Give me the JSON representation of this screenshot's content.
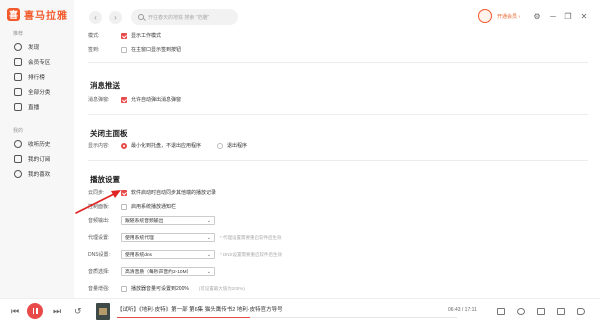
{
  "app": {
    "logo_text": "喜马拉雅",
    "logo_mark": "喜"
  },
  "sidebar": {
    "section1_label": "推荐",
    "items1": [
      {
        "label": "发现",
        "icon": "compass-icon"
      },
      {
        "label": "会员专区",
        "icon": "vip-icon"
      },
      {
        "label": "排行榜",
        "icon": "ranking-icon"
      },
      {
        "label": "全部分类",
        "icon": "category-icon"
      },
      {
        "label": "直播",
        "icon": "live-icon"
      }
    ],
    "section2_label": "我的",
    "items2": [
      {
        "label": "收听历史",
        "icon": "history-icon"
      },
      {
        "label": "我的订阅",
        "icon": "subscribe-icon"
      },
      {
        "label": "我的喜欢",
        "icon": "like-icon"
      }
    ]
  },
  "topbar": {
    "back": "‹",
    "forward": "›",
    "search_placeholder": "开往春天的地铁 搜索 \"范雕\"",
    "vip_label": "开通会员",
    "vip_arrow": "›",
    "win_ctrls": [
      "⚙",
      "─",
      "❐",
      "✕"
    ]
  },
  "settings": {
    "mode_label": "模式:",
    "mode_option": "显示工作模式",
    "sign_label": "签到:",
    "sign_option": "在主窗口显示签到按钮",
    "push_title": "消息推送",
    "push_label": "消息弹窗:",
    "push_option": "允许自动弹出消息弹窗",
    "close_title": "关闭主面板",
    "close_label": "显示内容:",
    "close_option1": "最小化到托盘，不退出应用程序",
    "close_option2": "退出程序",
    "play_title": "播放设置",
    "cloud_label": "云同步:",
    "cloud_option": "软件启动时自动同步其他端的播放记录",
    "control_label": "控制面板:",
    "control_option": "启用系统播放通知栏",
    "audio_out_label": "音频输出:",
    "audio_out_value": "跟随系统音频输出",
    "proxy_label": "代理设置:",
    "proxy_value": "使用系统代理",
    "proxy_hint": "* 代理设置需要重启软件后生效",
    "dns_label": "DNS设置:",
    "dns_value": "使用系统dns",
    "dns_hint": "* DNS设置需要重启软件后生效",
    "quality_label": "音质选择:",
    "quality_value": "高清音质（每秒声音约2-10M）",
    "boost_label": "音量增强:",
    "boost_option": "播放器音量可设置到200%",
    "boost_hint": "(可设置最大值为200%)",
    "select_arrow": "⌄"
  },
  "player": {
    "prev": "⏮",
    "next": "⏭",
    "rewind": "↺",
    "forward15": "↻",
    "track_title": "【试听】《地利·皮特》第一部 第6集 猫头鹰传书2  地利·皮特官方导号",
    "time": "06:43 / 17:11",
    "progress": 0.39
  },
  "colors": {
    "accent": "#e84a4a",
    "brand": "#f25a2b"
  }
}
